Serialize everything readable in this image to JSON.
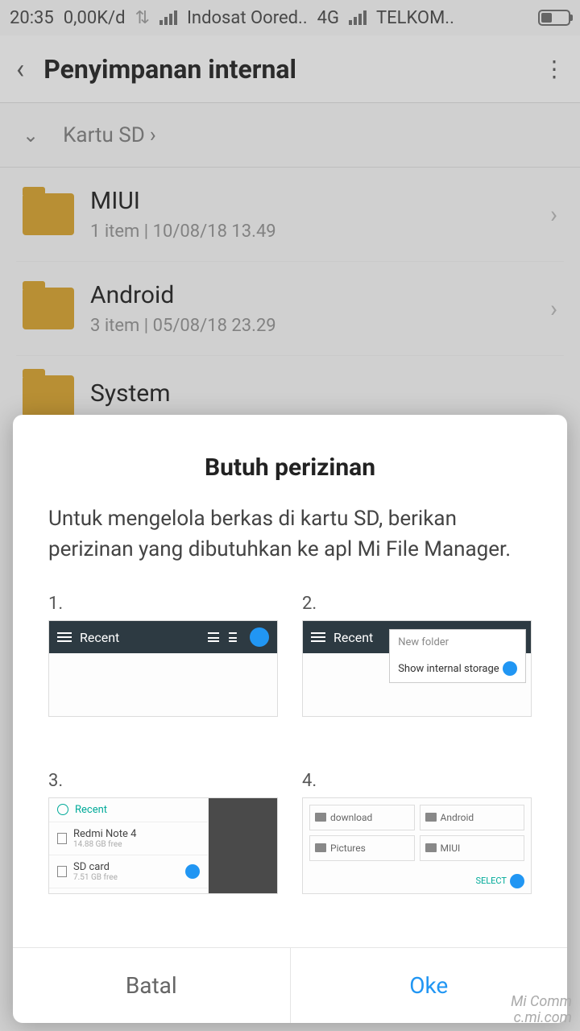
{
  "status": {
    "time": "20:35",
    "data_rate": "0,00K/d",
    "carrier1": "Indosat Oored..",
    "network": "4G",
    "carrier2": "TELKOM.."
  },
  "header": {
    "title": "Penyimpanan internal"
  },
  "breadcrumb": {
    "label": "Kartu SD"
  },
  "folders": [
    {
      "name": "MIUI",
      "meta": "1 item  |  10/08/18 13.49"
    },
    {
      "name": "Android",
      "meta": "3 item  |  05/08/18 23.29"
    },
    {
      "name": "System",
      "meta": ""
    }
  ],
  "dialog": {
    "title": "Butuh perizinan",
    "body": "Untuk mengelola berkas di kartu SD, berikan perizinan yang dibutuhkan ke apl Mi File Manager.",
    "steps": {
      "s1": "1.",
      "s2": "2.",
      "s3": "3.",
      "s4": "4."
    },
    "thumb": {
      "recent": "Recent",
      "new_folder": "New folder",
      "show_internal": "Show internal storage",
      "device": "Redmi Note 4",
      "device_free": "14.88 GB free",
      "sd": "SD card",
      "sd_free": "7.51 GB free",
      "f_download": "download",
      "f_android": "Android",
      "f_pictures": "Pictures",
      "f_miui": "MIUI",
      "select": "SELECT"
    },
    "cancel": "Batal",
    "ok": "Oke"
  },
  "watermark": {
    "l1": "Mi Comm",
    "l2": "c.mi.com"
  }
}
